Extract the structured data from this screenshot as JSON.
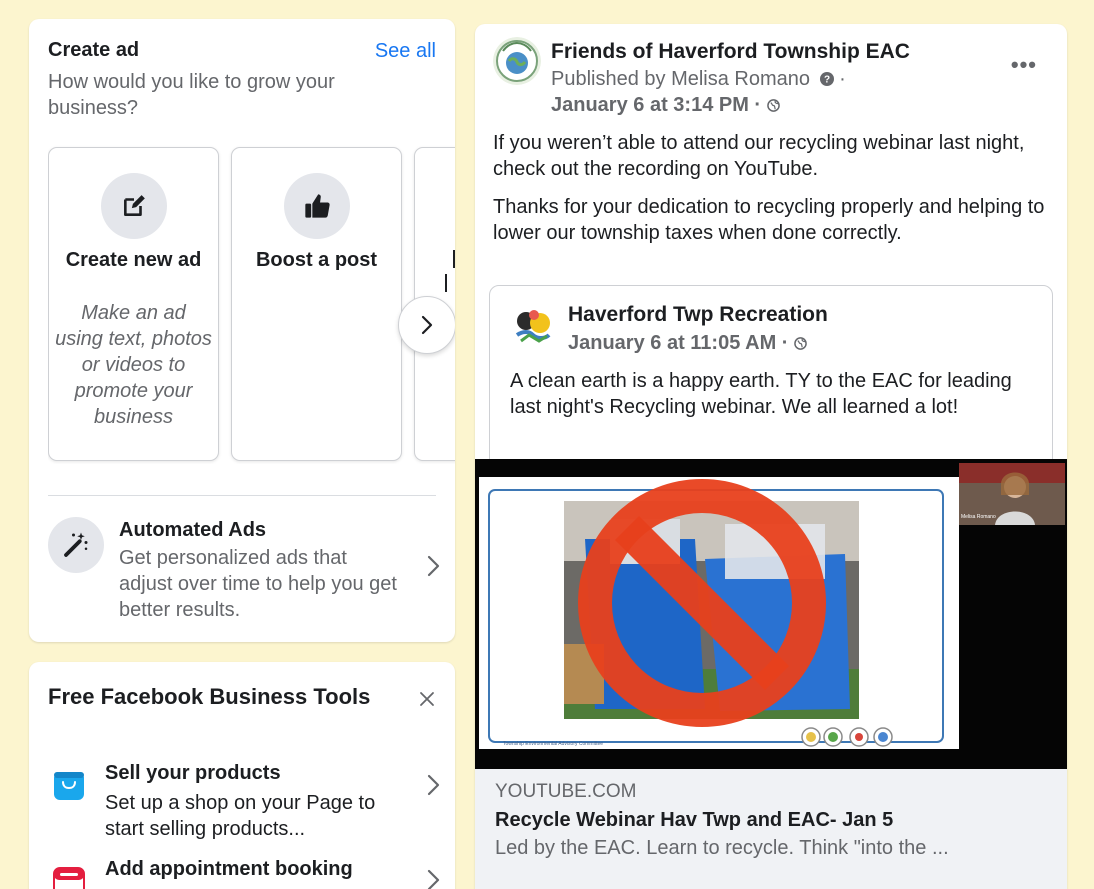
{
  "create_ad": {
    "title": "Create ad",
    "see_all": "See all",
    "subtitle": "How would you like to grow your business?",
    "tiles": [
      {
        "label": "Create new ad",
        "description": "Make an ad using text, photos or videos to promote your business",
        "icon": "edit-square-icon"
      },
      {
        "label": "Boost a post",
        "description": "",
        "icon": "thumbs-up-icon"
      },
      {
        "label": "",
        "description": "",
        "icon": ""
      }
    ],
    "next_icon": "chevron-right-icon",
    "automated_ads": {
      "title": "Automated Ads",
      "description": "Get personalized ads that adjust over time to help you get better results.",
      "icon": "magic-wand-icon"
    }
  },
  "business_tools": {
    "title": "Free Facebook Business Tools",
    "close_icon": "close-icon",
    "items": [
      {
        "title": "Sell your products",
        "description": "Set up a shop on your Page to start selling products...",
        "icon": "shopping-bag-icon",
        "color": "#1aa7ec"
      },
      {
        "title": "Add appointment booking",
        "description": "",
        "icon": "calendar-icon",
        "color": "#e41e3f"
      }
    ]
  },
  "post": {
    "page_name": "Friends of Haverford Township EAC",
    "published_by": "Published by Melisa Romano",
    "time": "January 6 at 3:14 PM ·",
    "more_label": "•••",
    "text_1": "If you weren’t able to attend our recycling webinar last night, check out the recording on YouTube.",
    "text_2": "Thanks for your dedication to recycling properly and helping to lower our township taxes when done correctly.",
    "shared": {
      "page_name": "Haverford Twp Recreation",
      "time": "January 6 at 11:05 AM ·",
      "text": "A clean earth is a happy earth.  TY to the EAC for leading last night's Recycling webinar.  We all learned a lot!"
    },
    "video": {
      "participant_name": "Melisa Romano",
      "footer_text": "Township Environmental Advisory Committee"
    },
    "link": {
      "domain": "YOUTUBE.COM",
      "title": "Recycle Webinar Hav Twp and EAC- Jan 5",
      "description": "Led by the EAC. Learn to recycle. Think \"into the ..."
    }
  },
  "colors": {
    "background": "#fcf5cf",
    "link_blue": "#1877f2",
    "secondary_text": "#65676b",
    "prohibit_red": "#e8401c"
  }
}
